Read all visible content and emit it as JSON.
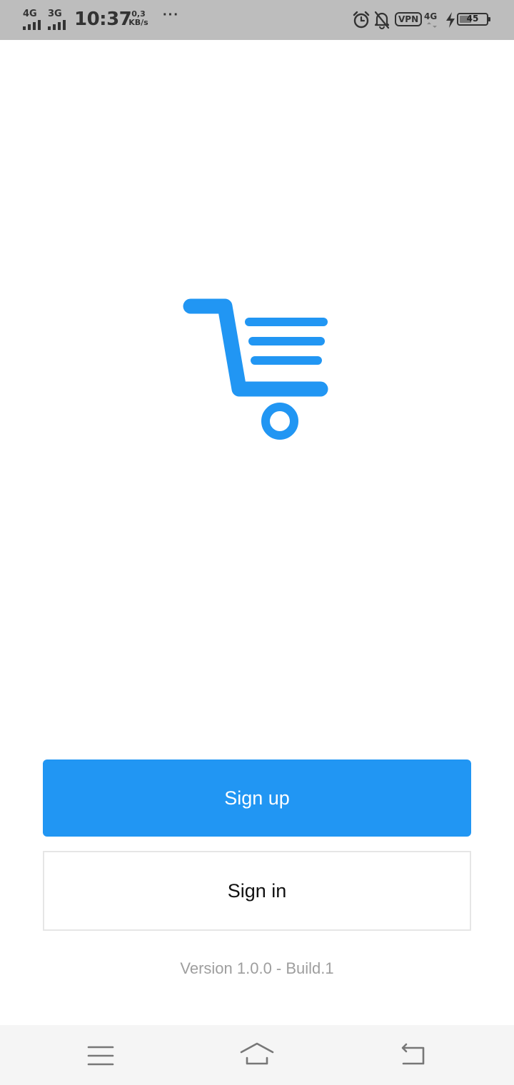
{
  "status_bar": {
    "sim1_label": "4G",
    "sim2_label": "3G",
    "time": "10:37",
    "net_speed_value": "0,3",
    "net_speed_unit": "KB/s",
    "more_indicator": "···",
    "vpn_label": "VPN",
    "data_network_label": "4G",
    "battery_level": "45",
    "battery_fraction": 0.45
  },
  "app": {
    "logo_icon": "shopping-cart-icon",
    "brand_color": "#2196f3"
  },
  "actions": {
    "signup_label": "Sign up",
    "signin_label": "Sign in"
  },
  "footer": {
    "version_text": "Version 1.0.0 - Build.1"
  },
  "nav_bar": {
    "menu_icon": "menu-icon",
    "home_icon": "home-icon",
    "back_icon": "back-icon"
  }
}
